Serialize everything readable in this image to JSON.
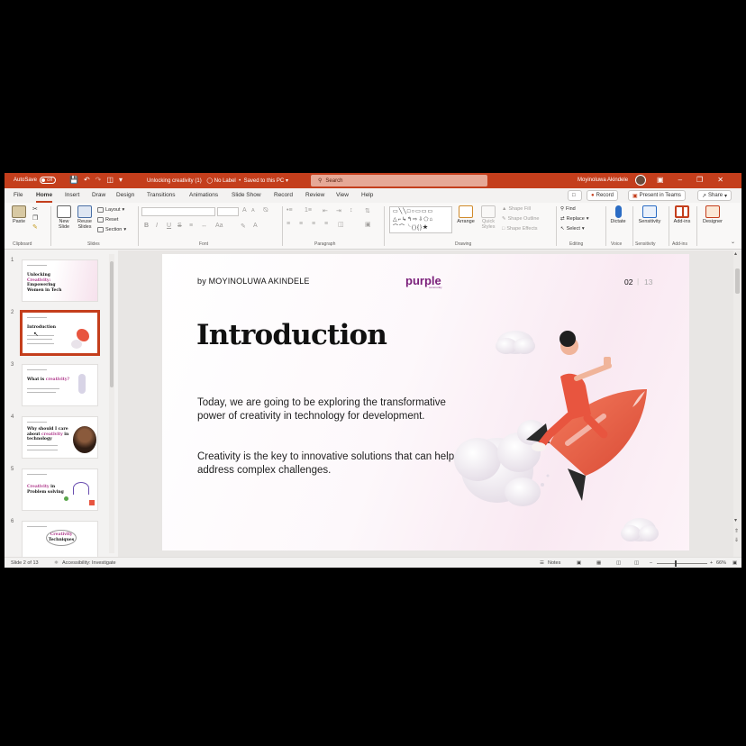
{
  "titlebar": {
    "autosave_label": "AutoSave",
    "autosave_state": "Off",
    "document_name": "Unlocking creativity (1)",
    "label_status": "No Label",
    "save_status": "Saved to this PC",
    "search_placeholder": "Search",
    "user_name": "Moyinoluwa Akindele"
  },
  "menu": {
    "tabs": [
      "File",
      "Home",
      "Insert",
      "Draw",
      "Design",
      "Transitions",
      "Animations",
      "Slide Show",
      "Record",
      "Review",
      "View",
      "Help"
    ],
    "active_tab": "Home",
    "record_button": "Record",
    "present_teams_button": "Present in Teams",
    "share_button": "Share"
  },
  "ribbon": {
    "clipboard": {
      "paste": "Paste",
      "label": "Clipboard"
    },
    "slides": {
      "new_slide_1": "New",
      "new_slide_2": "Slide",
      "reuse_1": "Reuse",
      "reuse_2": "Slides",
      "layout": "Layout",
      "reset": "Reset",
      "section": "Section",
      "label": "Slides"
    },
    "font": {
      "label": "Font",
      "bold": "B",
      "italic": "I",
      "underline": "U",
      "strike": "S",
      "grow": "A",
      "shrink": "A"
    },
    "paragraph": {
      "label": "Paragraph"
    },
    "drawing": {
      "arrange": "Arrange",
      "quick_styles_1": "Quick",
      "quick_styles_2": "Styles",
      "shape_fill": "Shape Fill",
      "shape_outline": "Shape Outline",
      "shape_effects": "Shape Effects",
      "label": "Drawing"
    },
    "editing": {
      "find": "Find",
      "replace": "Replace",
      "select": "Select",
      "label": "Editing"
    },
    "voice": {
      "dictate": "Dictate",
      "label": "Voice"
    },
    "sensitivity": {
      "sensitivity": "Sensitivity",
      "label": "Sensitivity"
    },
    "addins": {
      "addins": "Add-ins",
      "label": "Add-ins"
    },
    "designer": {
      "designer": "Designer"
    }
  },
  "thumbnails": [
    {
      "number": "1",
      "title_a": "Unlocking ",
      "title_accent": "Creativity:",
      "title_b": " Empowering Women in Tech"
    },
    {
      "number": "2",
      "title_a": "Introduction",
      "title_accent": "",
      "title_b": ""
    },
    {
      "number": "3",
      "title_a": "What is ",
      "title_accent": "creativity?",
      "title_b": ""
    },
    {
      "number": "4",
      "title_a": "Why should I care about ",
      "title_accent": "creativity",
      "title_b": " in technology"
    },
    {
      "number": "5",
      "title_a": "",
      "title_accent": "Creativity",
      "title_b": " in Problem solving"
    },
    {
      "number": "6",
      "title_a": "",
      "title_accent": "Creativity",
      "title_b": " Techniques"
    }
  ],
  "slide": {
    "author": "by MOYINOLUWA AKINDELE",
    "logo": "purple",
    "logo_sub": "community",
    "page_number": "02",
    "page_separator": "|",
    "page_total": "13",
    "title": "Introduction",
    "paragraph1": "Today, we are going to be exploring the transformative power of creativity in technology for development.",
    "paragraph2": "Creativity is the key to innovative solutions that can help address complex challenges."
  },
  "statusbar": {
    "slide_count": "Slide 2 of 13",
    "accessibility": "Accessibility: Investigate",
    "notes": "Notes",
    "zoom": "66%"
  },
  "colors": {
    "accent": "#c43e1c",
    "brand_purple": "#7a1f7a",
    "rocket": "#e8553f"
  }
}
